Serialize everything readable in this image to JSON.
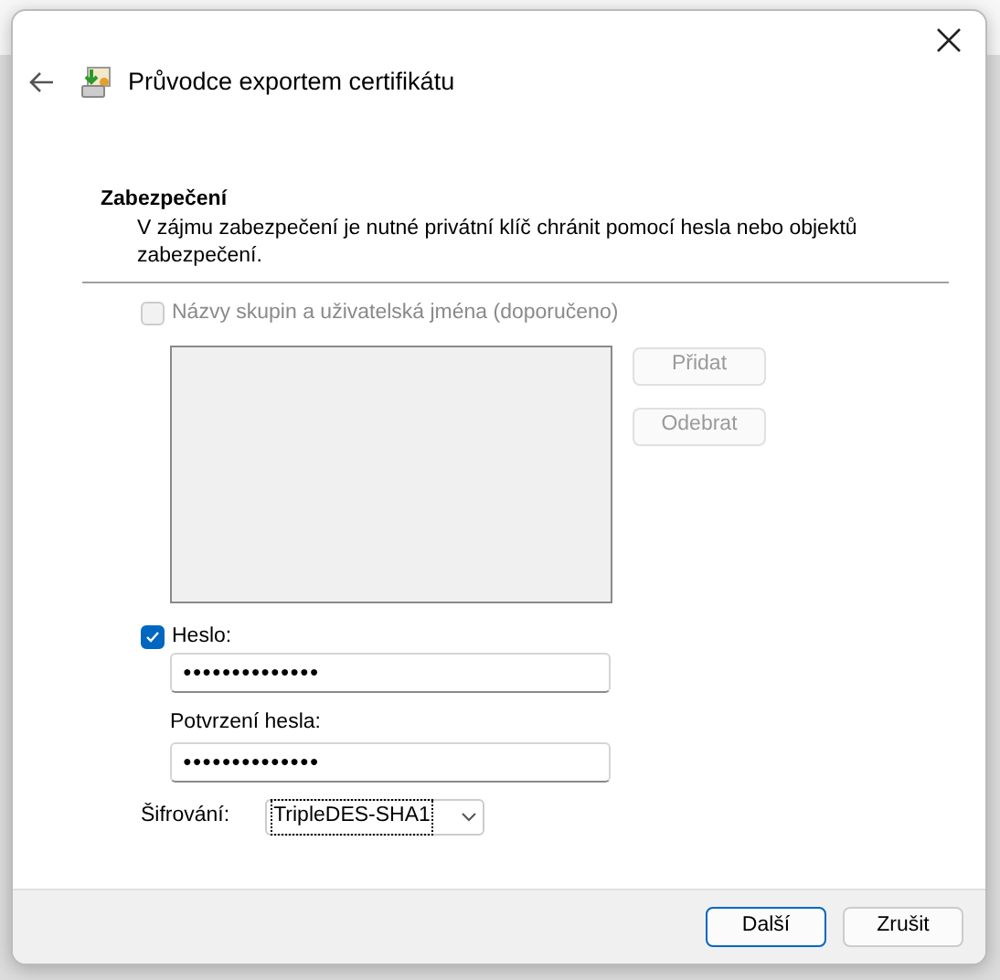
{
  "window": {
    "title": "Průvodce exportem certifikátu"
  },
  "section": {
    "heading": "Zabezpečení",
    "description": "V zájmu zabezpečení je nutné privátní klíč chránit pomocí hesla nebo objektů zabezpečení."
  },
  "groups_option": {
    "label": "Názvy skupin a uživatelská jména (doporučeno)",
    "checked": false,
    "disabled": true
  },
  "group_buttons": [
    {
      "label": "Přidat",
      "disabled": true
    },
    {
      "label": "Odebrat",
      "disabled": true
    }
  ],
  "password_option": {
    "label": "Heslo:",
    "checked": true
  },
  "password": {
    "value": "●●●●●●●●●●●●●●"
  },
  "confirm": {
    "label": "Potvrzení hesla:",
    "value": "●●●●●●●●●●●●●●"
  },
  "encryption": {
    "label": "Šifrování:",
    "value": "TripleDES-SHA1"
  },
  "buttons": [
    {
      "label": "Další",
      "default": true
    },
    {
      "label": "Zrušit",
      "default": false
    }
  ]
}
